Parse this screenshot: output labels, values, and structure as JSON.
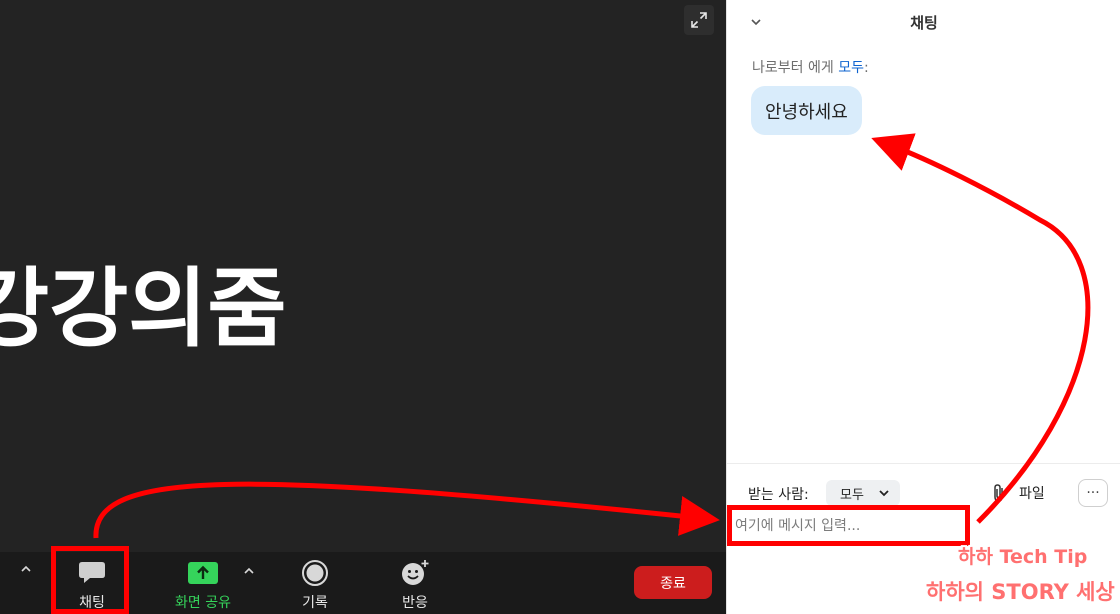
{
  "meeting": {
    "shared_screen_text": "강강의줌"
  },
  "toolbar": {
    "chat_label": "채팅",
    "share_label": "화면 공유",
    "record_label": "기록",
    "reactions_label": "반응",
    "end_label": "종료"
  },
  "chat": {
    "title": "채팅",
    "message_from": "나로부터 에게",
    "message_to": "모두",
    "message_colon": ":",
    "message_text": "안녕하세요",
    "recipient_label": "받는 사람:",
    "recipient_value": "모두",
    "file_label": "파일",
    "more_label": "···",
    "input_placeholder": "여기에 메시지 입력..."
  },
  "watermark": {
    "line1": "하하 Tech Tip",
    "line2": "하하의 STORY 세상"
  },
  "colors": {
    "annotation": "#ff0000",
    "share_green": "#35d45b",
    "end_red": "#cc1d1d",
    "link_blue": "#0e63cf",
    "bubble_blue": "#d9ecfb"
  }
}
